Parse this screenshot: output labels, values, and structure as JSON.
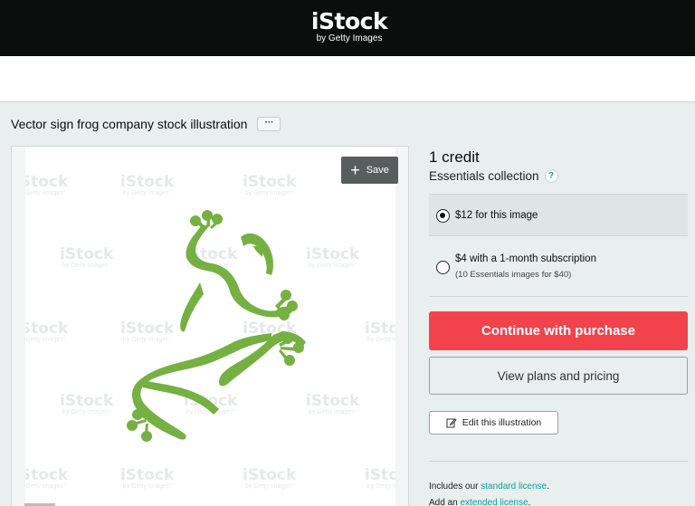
{
  "header": {
    "logo_main": "iStock",
    "logo_sub": "by Getty Images"
  },
  "page": {
    "title": "Vector sign frog company stock illustration",
    "more_label": "···"
  },
  "preview": {
    "save_label": "Save",
    "watermark_main": "iStock",
    "watermark_sub": "by Getty Images°",
    "frog_color": "#76b043"
  },
  "purchase": {
    "credit": "1 credit",
    "collection": "Essentials collection",
    "help_symbol": "?",
    "option1_label": "$12 for this image",
    "option2_label": "$4 with a 1-month subscription",
    "option2_sub": "(10 Essentials images for $40)",
    "buy_label": "Continue with purchase",
    "plans_label": "View plans and pricing",
    "edit_label": "Edit this illustration",
    "license_prefix": "Includes our ",
    "license_link": "standard license",
    "license_suffix": ".",
    "ext_prefix": "Add an ",
    "ext_link": "extended license",
    "ext_suffix": "."
  },
  "colors": {
    "brand_red": "#f2434c",
    "link_teal": "#08a39a",
    "header_bg": "#0c0d0d"
  }
}
